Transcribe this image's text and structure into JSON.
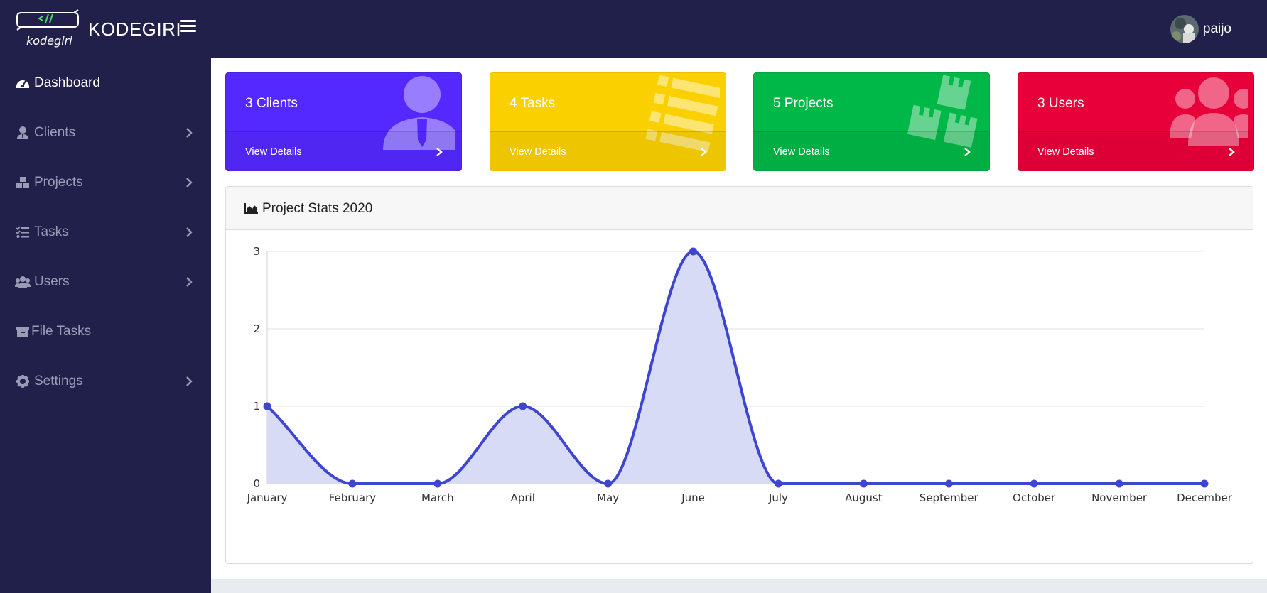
{
  "app": {
    "logo_text": "kodegiri",
    "brand": "KODEGIRI"
  },
  "user": {
    "name": "paijo"
  },
  "sidebar": {
    "items": [
      {
        "label": "Dashboard",
        "icon": "tachometer-icon",
        "active": true,
        "has_submenu": false
      },
      {
        "label": "Clients",
        "icon": "user-tie-icon",
        "active": false,
        "has_submenu": true
      },
      {
        "label": "Projects",
        "icon": "cubes-icon",
        "active": false,
        "has_submenu": true
      },
      {
        "label": "Tasks",
        "icon": "tasks-icon",
        "active": false,
        "has_submenu": true
      },
      {
        "label": "Users",
        "icon": "users-icon",
        "active": false,
        "has_submenu": true
      },
      {
        "label": "File Tasks",
        "icon": "archive-icon",
        "active": false,
        "has_submenu": false
      },
      {
        "label": "Settings",
        "icon": "cog-icon",
        "active": false,
        "has_submenu": true
      }
    ]
  },
  "cards": [
    {
      "title": "3 Clients",
      "link": "View Details",
      "color": "#5429ff",
      "icon": "user-tie-icon"
    },
    {
      "title": "4 Tasks",
      "link": "View Details",
      "color": "#fad000",
      "icon": "tasks-icon"
    },
    {
      "title": "5 Projects",
      "link": "View Details",
      "color": "#00b847",
      "icon": "cubes-icon"
    },
    {
      "title": "3 Users",
      "link": "View Details",
      "color": "#e8003a",
      "icon": "users-icon"
    }
  ],
  "chart_panel": {
    "title": "Project Stats 2020",
    "icon": "area-chart-icon"
  },
  "chart_data": {
    "type": "area",
    "categories": [
      "January",
      "February",
      "March",
      "April",
      "May",
      "June",
      "July",
      "August",
      "September",
      "October",
      "November",
      "December"
    ],
    "series": [
      {
        "values": [
          1,
          0,
          0,
          1,
          0,
          3,
          0,
          0,
          0,
          0,
          0,
          0
        ],
        "color": "#3d45d1",
        "fill": "#d8dbf5"
      }
    ],
    "ylim": [
      0,
      3
    ],
    "yticks": [
      0,
      1,
      2,
      3
    ],
    "grid": true,
    "smooth": true
  }
}
